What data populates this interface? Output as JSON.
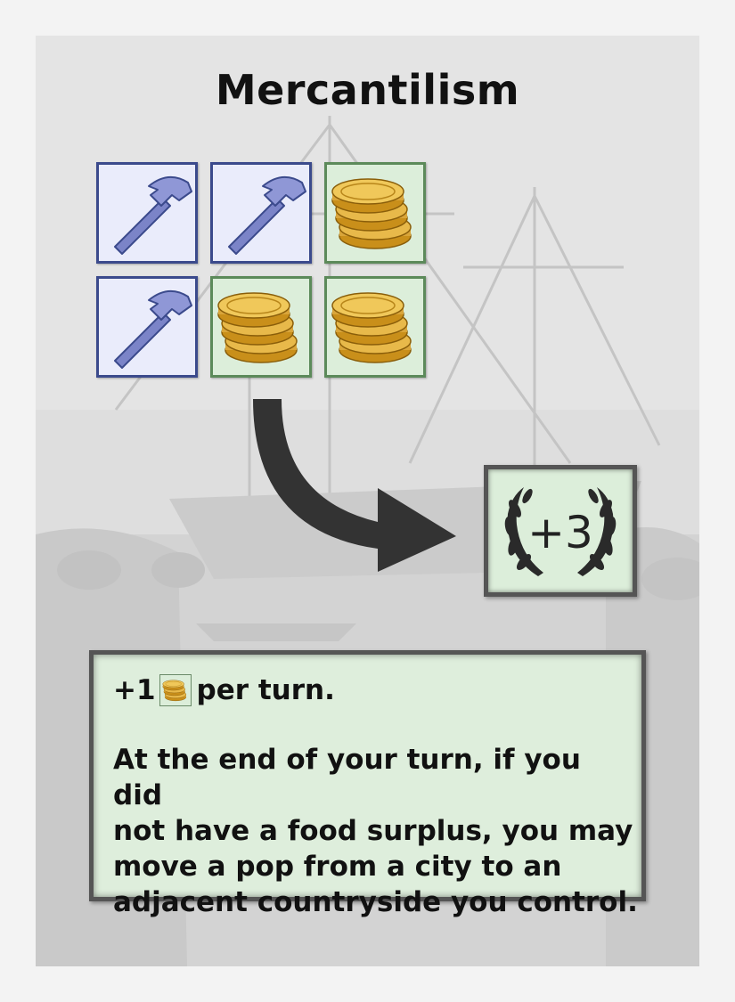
{
  "card": {
    "title": "Mercantilism",
    "cost_tiles": [
      {
        "resource": "hammer",
        "icon": "hammer-icon"
      },
      {
        "resource": "hammer",
        "icon": "hammer-icon"
      },
      {
        "resource": "gold",
        "icon": "coin-stack-icon"
      },
      {
        "resource": "hammer",
        "icon": "hammer-icon"
      },
      {
        "resource": "gold",
        "icon": "coin-stack-icon"
      },
      {
        "resource": "gold",
        "icon": "coin-stack-icon"
      }
    ],
    "reward": {
      "value": "+3",
      "icon": "laurel-wreath-icon"
    },
    "effect": {
      "prefix": "+1",
      "icon": "coin-stack-icon",
      "suffix": "per turn.",
      "body": "At the end of your turn, if you did\nnot have a food surplus, you may\nmove a pop from a city to an\nadjacent countryside you control."
    }
  },
  "colors": {
    "hammer_tile_bg": "#eaecfb",
    "hammer_tile_border": "#3b4a8c",
    "gold_tile_bg": "#dceeda",
    "gold_tile_border": "#5c8a5a",
    "text_box_bg": "#deeedc",
    "arrow": "#333333"
  }
}
